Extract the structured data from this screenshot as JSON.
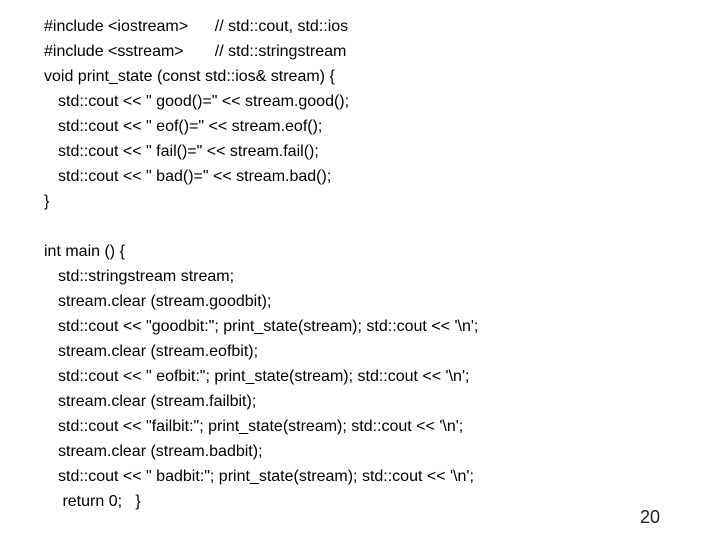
{
  "lines": [
    {
      "text": "#include <iostream>      // std::cout, std::ios",
      "indent": 0
    },
    {
      "text": "#include <sstream>       // std::stringstream",
      "indent": 0
    },
    {
      "text": "void print_state (const std::ios& stream) {",
      "indent": 0
    },
    {
      "text": "std::cout << \" good()=\" << stream.good();",
      "indent": 1
    },
    {
      "text": "std::cout << \" eof()=\" << stream.eof();",
      "indent": 1
    },
    {
      "text": "std::cout << \" fail()=\" << stream.fail();",
      "indent": 1
    },
    {
      "text": "std::cout << \" bad()=\" << stream.bad();",
      "indent": 1
    },
    {
      "text": "}",
      "indent": 0
    },
    {
      "text": "",
      "indent": 0,
      "blank": true
    },
    {
      "text": "int main () {",
      "indent": 0
    },
    {
      "text": "std::stringstream stream;",
      "indent": 1
    },
    {
      "text": "stream.clear (stream.goodbit);",
      "indent": 1
    },
    {
      "text": "std::cout << \"goodbit:\"; print_state(stream); std::cout << '\\n';",
      "indent": 1
    },
    {
      "text": "stream.clear (stream.eofbit);",
      "indent": 1
    },
    {
      "text": "std::cout << \" eofbit:\"; print_state(stream); std::cout << '\\n';",
      "indent": 1
    },
    {
      "text": "stream.clear (stream.failbit);",
      "indent": 1
    },
    {
      "text": "std::cout << \"failbit:\"; print_state(stream); std::cout << '\\n';",
      "indent": 1
    },
    {
      "text": "stream.clear (stream.badbit);",
      "indent": 1
    },
    {
      "text": "std::cout << \" badbit:\"; print_state(stream); std::cout << '\\n';",
      "indent": 1
    },
    {
      "text": " return 0;   }",
      "indent": 1
    }
  ],
  "page_number": "20"
}
